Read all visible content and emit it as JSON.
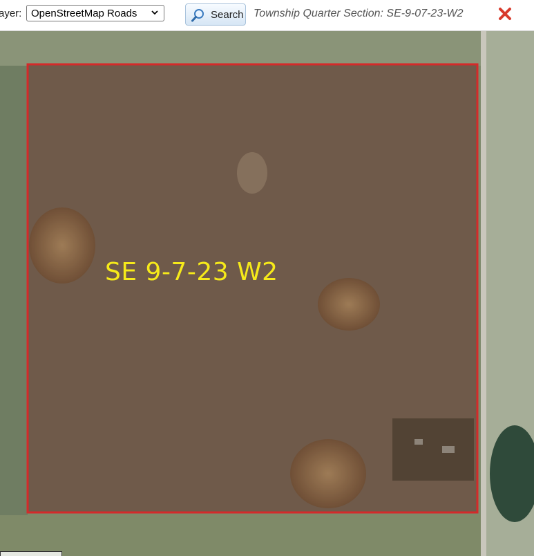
{
  "toolbar": {
    "layer_label": "ayer:",
    "layer_select_value": "OpenStreetMap Roads",
    "search_label": "Search",
    "section_title": "Township Quarter Section: SE-9-07-23-W2"
  },
  "map": {
    "parcel_label": "SE 9-7-23 W2",
    "parcel_outline_color": "#d42a2a",
    "parcel_label_color": "#f6ea1a"
  },
  "icons": {
    "search": "magnifier-icon",
    "close": "close-icon",
    "dropdown": "chevron-down-icon"
  }
}
